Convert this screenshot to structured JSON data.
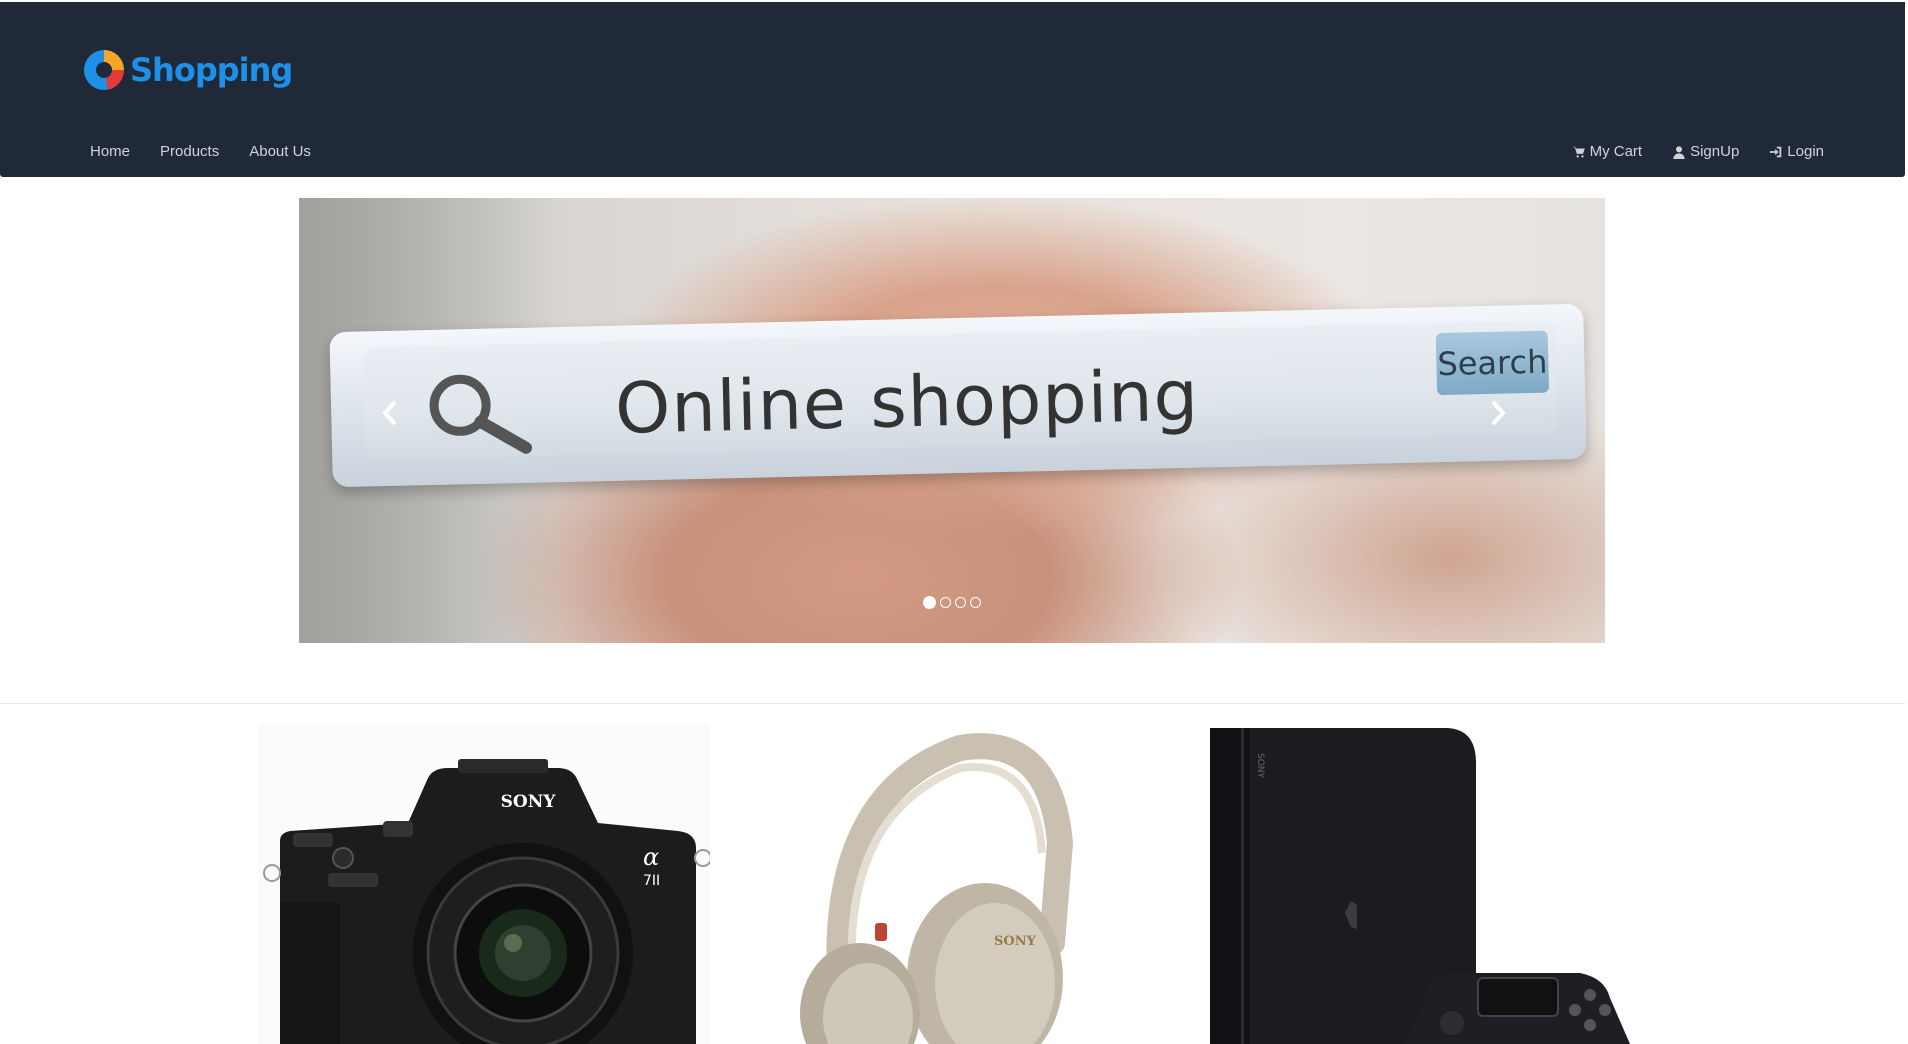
{
  "header": {
    "brand": "Shopping",
    "nav_left": [
      {
        "label": "Home"
      },
      {
        "label": "Products"
      },
      {
        "label": "About Us"
      }
    ],
    "nav_right": [
      {
        "label": "My Cart",
        "icon": "cart-icon"
      },
      {
        "label": "SignUp",
        "icon": "user-icon"
      },
      {
        "label": "Login",
        "icon": "login-icon"
      }
    ]
  },
  "carousel": {
    "slide_text": "Online shopping",
    "slide_button_text": "Search",
    "active_index": 0,
    "slide_count": 4
  },
  "products": {
    "camera_brand": "SONY",
    "camera_model_mark": "α",
    "camera_model_sub": "7II",
    "headphones_brand": "SONY",
    "console_brand": "SONY"
  },
  "colors": {
    "navbar": "#1f2937",
    "brand": "#1e90e8",
    "nav_text": "#cfd4da"
  }
}
